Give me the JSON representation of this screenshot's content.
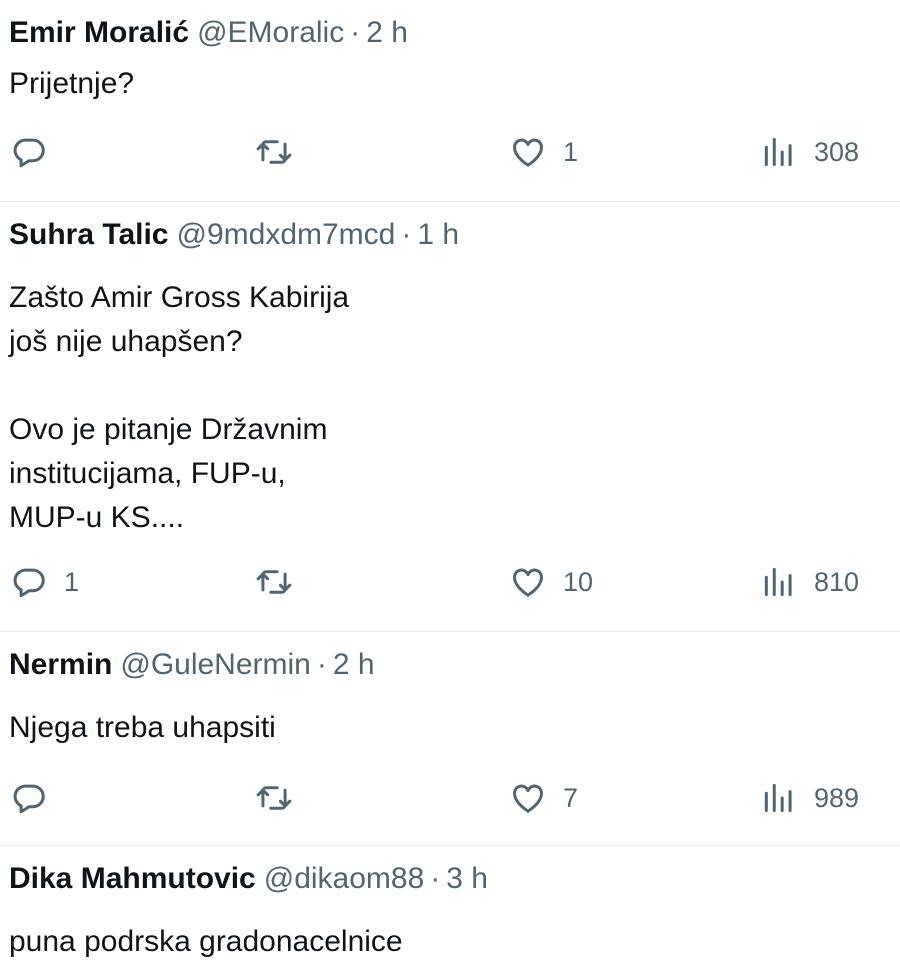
{
  "replies": [
    {
      "name": "Emir Moralić",
      "handle": "@EMoralic",
      "separator": "·",
      "time": "2 h",
      "text": "Prijetnje?",
      "reply_count": "",
      "retweet_count": "",
      "like_count": "1",
      "view_count": "308"
    },
    {
      "name": "Suhra Talic",
      "handle": "@9mdxdm7mcd",
      "separator": "·",
      "time": "1 h",
      "text": "Zašto Amir Gross Kabirija\njoš nije uhapšen?\n\nOvo je pitanje Državnim\ninstitucijama, FUP-u,\nMUP-u KS....",
      "reply_count": "1",
      "retweet_count": "",
      "like_count": "10",
      "view_count": "810"
    },
    {
      "name": "Nermin",
      "handle": "@GuleNermin",
      "separator": "·",
      "time": "2 h",
      "text": "Njega treba uhapsiti",
      "reply_count": "",
      "retweet_count": "",
      "like_count": "7",
      "view_count": "989"
    },
    {
      "name": "Dika Mahmutovic",
      "handle": "@dikaom88",
      "separator": "·",
      "time": "3 h",
      "text": "puna podrska gradonacelnice"
    }
  ],
  "icons": {
    "reply": "speech-bubble-icon",
    "retweet": "retweet-icon",
    "like": "heart-icon",
    "views": "bar-chart-icon"
  },
  "colors": {
    "text_primary": "#0f1419",
    "text_secondary": "#536471",
    "divider": "#e7e9ea"
  }
}
